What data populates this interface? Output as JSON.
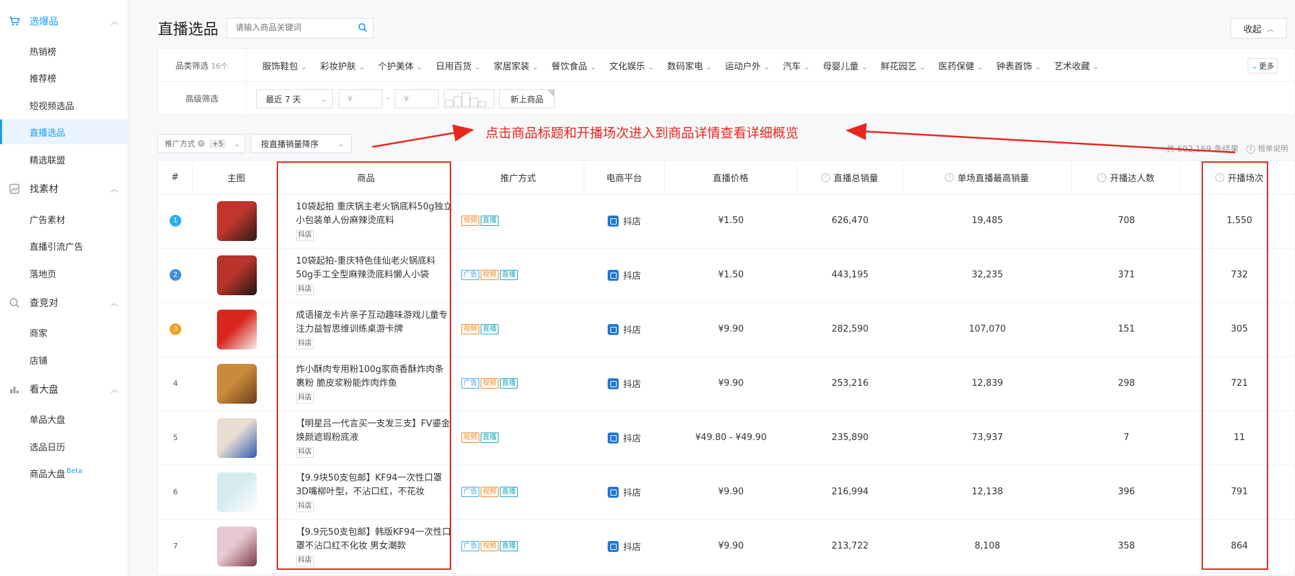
{
  "sidebar": {
    "sections": [
      {
        "icon": "cart-icon",
        "label": "选爆品",
        "items": [
          "热销榜",
          "推荐榜",
          "短视频选品",
          "直播选品",
          "精选联盟"
        ]
      },
      {
        "icon": "image-icon",
        "label": "找素材",
        "items": [
          "广告素材",
          "直播引流广告",
          "落地页"
        ]
      },
      {
        "icon": "compare-icon",
        "label": "查竞对",
        "items": [
          "商家",
          "店铺"
        ]
      },
      {
        "icon": "bar-chart-icon",
        "label": "看大盘",
        "items": [
          "单品大盘",
          "选品日历",
          "商品大盘"
        ]
      }
    ],
    "active_item": "直播选品",
    "beta": "Beta"
  },
  "header": {
    "title": "直播选品",
    "search_placeholder": "请输入商品关键词",
    "collapse_label": "收起"
  },
  "filters": {
    "category_label": "品类筛选",
    "category_count": "16个",
    "categories": [
      "服饰鞋包",
      "彩妆护肤",
      "个护美体",
      "日用百货",
      "家居家装",
      "餐饮食品",
      "文化娱乐",
      "数码家电",
      "运动户外",
      "汽车",
      "母婴儿童",
      "鲜花园艺",
      "医药保健",
      "钟表首饰",
      "艺术收藏"
    ],
    "more_label": "更多",
    "advanced_label": "高级筛选",
    "date_range": "最近 7 天",
    "price_min_placeholder": "¥",
    "price_max_placeholder": "¥",
    "price_sep": "-",
    "new_product": "新上商品"
  },
  "toolbar": {
    "promo_chip": "推广方式",
    "promo_extra": "+5",
    "sort": "按直播销量降序",
    "result_count": "共 602,169 条结果",
    "rank_note": "榜单说明"
  },
  "annotation": "点击商品标题和开播场次进入到商品详情查看详细概览",
  "table": {
    "columns": [
      "#",
      "主图",
      "商品",
      "推广方式",
      "电商平台",
      "直播价格",
      "直播总销量",
      "单场直播最高销量",
      "开播达人数",
      "开播场次"
    ],
    "rows": [
      {
        "rank": "1",
        "title": "10袋起拍 重庆锅主老火锅底料50g独立小包装单人份麻辣烫底料",
        "shop": "抖店",
        "tags": [
          "视频",
          "直播"
        ],
        "platform": "抖店",
        "price": "¥1.50",
        "total": "626,470",
        "max": "19,485",
        "hosts": "708",
        "sessions": "1,550"
      },
      {
        "rank": "2",
        "title": "10袋起拍-重庆特色佳仙老火锅底料50g手工全型麻辣烫底料懒人小袋",
        "shop": "抖店",
        "tags": [
          "广告",
          "视频",
          "直播"
        ],
        "platform": "抖店",
        "price": "¥1.50",
        "total": "443,195",
        "max": "32,235",
        "hosts": "371",
        "sessions": "732"
      },
      {
        "rank": "3",
        "title": "成语接龙卡片亲子互动趣味游戏儿童专注力益智思维训练桌游卡牌",
        "shop": "抖店",
        "tags": [
          "视频",
          "直播"
        ],
        "platform": "抖店",
        "price": "¥9.90",
        "total": "282,590",
        "max": "107,070",
        "hosts": "151",
        "sessions": "305"
      },
      {
        "rank": "4",
        "title": "炸小酥肉专用粉100g家商香酥炸肉条 裹粉 脆皮浆粉能炸肉炸鱼",
        "shop": "抖店",
        "tags": [
          "广告",
          "视频",
          "直播"
        ],
        "platform": "抖店",
        "price": "¥9.90",
        "total": "253,216",
        "max": "12,839",
        "hosts": "298",
        "sessions": "721"
      },
      {
        "rank": "5",
        "title": "【明星吕一代言买一支发三支】FV鎏金焕颜遮瑕粉底液",
        "shop": "抖店",
        "tags": [
          "视频",
          "直播"
        ],
        "platform": "抖店",
        "price": "¥49.80 - ¥49.90",
        "total": "235,890",
        "max": "73,937",
        "hosts": "7",
        "sessions": "11"
      },
      {
        "rank": "6",
        "title": "【9.9块50支包邮】KF94一次性口罩3D嘴柳叶型，不沾口红，不花妆",
        "shop": "抖店",
        "tags": [
          "广告",
          "视频",
          "直播"
        ],
        "platform": "抖店",
        "price": "¥9.90",
        "total": "216,994",
        "max": "12,138",
        "hosts": "396",
        "sessions": "791"
      },
      {
        "rank": "7",
        "title": "【9.9元50支包邮】韩版KF94一次性口罩不沾口红不化妆 男女潮款",
        "shop": "抖店",
        "tags": [
          "广告",
          "视频",
          "直播"
        ],
        "platform": "抖店",
        "price": "¥9.90",
        "total": "213,722",
        "max": "8,108",
        "hosts": "358",
        "sessions": "864"
      }
    ]
  },
  "colors": {
    "accent": "#1a9cf0",
    "annotation": "#e8271e",
    "rank1": "#2ab0e6",
    "rank2": "#3f8fdc",
    "rank3": "#f2a11e"
  }
}
